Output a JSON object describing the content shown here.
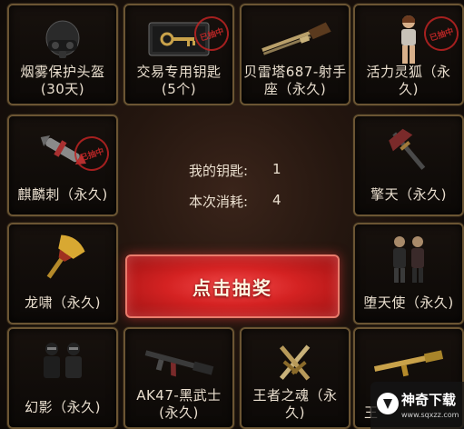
{
  "items": [
    {
      "id": "smoke-helmet",
      "line1": "烟雾保护头盔",
      "line2": "(30天)"
    },
    {
      "id": "trade-key",
      "line1": "交易专用钥匙",
      "line2": "(5个)"
    },
    {
      "id": "beretta-687",
      "line1": "贝雷塔687-射手",
      "line2": "座（永久)"
    },
    {
      "id": "vitality-fox",
      "line1": "活力灵狐（永",
      "line2": "久)"
    },
    {
      "id": "qilin-thorn",
      "line1": "麒麟刺（永久)",
      "line2": ""
    },
    {
      "id": "qingtian",
      "line1": "擎天（永久)",
      "line2": ""
    },
    {
      "id": "dragon-roar",
      "line1": "龙啸（永久)",
      "line2": ""
    },
    {
      "id": "fallen-angel",
      "line1": "堕天使（永久)",
      "line2": ""
    },
    {
      "id": "phantom",
      "line1": "幻影（永久)",
      "line2": ""
    },
    {
      "id": "ak47-black-warrior",
      "line1": "AK47-黑武士",
      "line2": "(永久)"
    },
    {
      "id": "king-soul",
      "line1": "王者之魂（永",
      "line2": "久)"
    },
    {
      "id": "partial-item",
      "line1": "王",
      "line2": ""
    }
  ],
  "stamp_text": "已抽中",
  "status": {
    "keys_label": "我的钥匙:",
    "keys_value": "1",
    "cost_label": "本次消耗:",
    "cost_value": "4"
  },
  "draw_button": "点击抽奖",
  "watermark": {
    "title": "神奇下载",
    "url": "www.sqxzz.com"
  },
  "colors": {
    "border": "#6b5533",
    "button": "#d42222",
    "text": "#eadfcf"
  }
}
